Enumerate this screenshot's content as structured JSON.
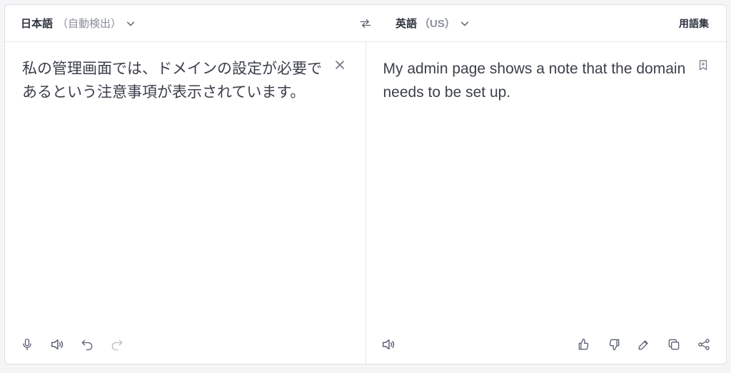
{
  "header": {
    "source_lang": "日本語",
    "source_detect": "（自動検出）",
    "target_lang": "英語",
    "target_variant": "（US）",
    "glossary_label": "用語集"
  },
  "source": {
    "text": "私の管理画面では、ドメインの設定が必要であるという注意事項が表示されています。"
  },
  "target": {
    "text": "My admin page shows a note that the domain needs to be set up."
  }
}
